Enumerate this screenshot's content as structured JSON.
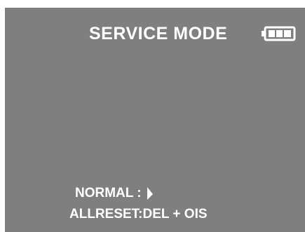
{
  "screen": {
    "title": "SERVICE MODE",
    "battery_icon": "battery-full-icon",
    "lines": {
      "normal_label": "NORMAL :",
      "allreset_label": "ALLRESET:DEL + OIS"
    },
    "selection_icon": "right-pointer-icon",
    "colors": {
      "background": "#7f7f7f",
      "text": "#ffffff"
    }
  }
}
